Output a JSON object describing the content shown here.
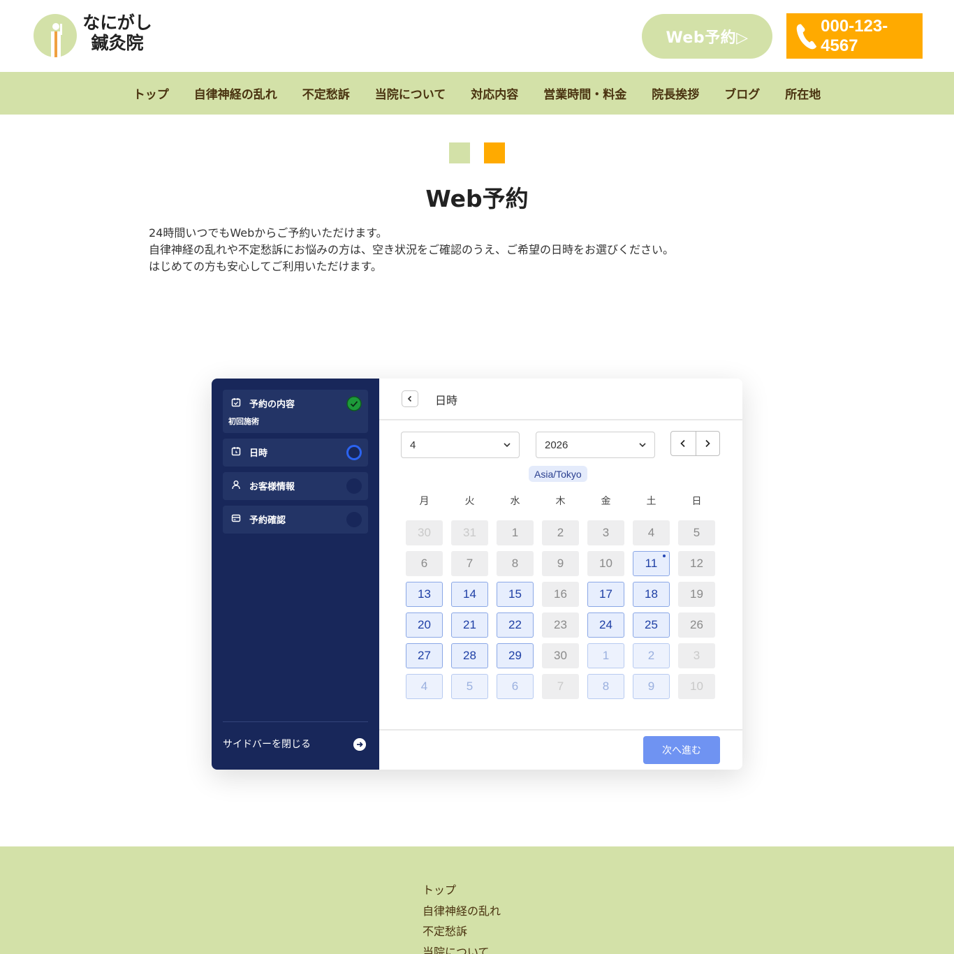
{
  "header": {
    "logo_line1": "なにがし",
    "logo_line2": "鍼灸院",
    "web_button": "Web予約▷",
    "tel_button": "000-123-4567"
  },
  "colors": {
    "green": "#d3e1a8",
    "orange": "#ffaa00",
    "navy": "#18275a",
    "accent_blue": "#6f93f2"
  },
  "nav": [
    "トップ",
    "自律神経の乱れ",
    "不定愁訴",
    "当院について",
    "対応内容",
    "営業時間・料金",
    "院長挨拶",
    "ブログ",
    "所在地"
  ],
  "page": {
    "title": "Web予約",
    "intro": [
      "24時間いつでもWebからご予約いただけます。",
      "自律神経の乱れや不定愁訴にお悩みの方は、空き状況をご確認のうえ、ご希望の日時をお選びください。",
      "はじめての方も安心してご利用いただけます。"
    ]
  },
  "booking": {
    "steps": [
      {
        "label": "予約の内容",
        "sub": "初回施術",
        "icon": "calendar-icon",
        "status": "done"
      },
      {
        "label": "日時",
        "sub": "",
        "icon": "calendar-clock-icon",
        "status": "current"
      },
      {
        "label": "お客様情報",
        "sub": "",
        "icon": "user-icon",
        "status": "pending"
      },
      {
        "label": "予約確認",
        "sub": "",
        "icon": "card-icon",
        "status": "pending"
      }
    ],
    "close_sidebar": "サイドバーを閉じる",
    "section_title": "日時",
    "month_value": "4",
    "year_value": "2026",
    "timezone": "Asia/Tokyo",
    "weekdays": [
      "月",
      "火",
      "水",
      "木",
      "金",
      "土",
      "日"
    ],
    "weeks": [
      [
        {
          "d": "30",
          "s": "other-dis"
        },
        {
          "d": "31",
          "s": "other-dis"
        },
        {
          "d": "1",
          "s": "dis"
        },
        {
          "d": "2",
          "s": "dis"
        },
        {
          "d": "3",
          "s": "dis"
        },
        {
          "d": "4",
          "s": "dis"
        },
        {
          "d": "5",
          "s": "dis"
        }
      ],
      [
        {
          "d": "6",
          "s": "dis"
        },
        {
          "d": "7",
          "s": "dis"
        },
        {
          "d": "8",
          "s": "dis"
        },
        {
          "d": "9",
          "s": "dis"
        },
        {
          "d": "10",
          "s": "dis"
        },
        {
          "d": "11",
          "s": "av today"
        },
        {
          "d": "12",
          "s": "dis"
        }
      ],
      [
        {
          "d": "13",
          "s": "av"
        },
        {
          "d": "14",
          "s": "av"
        },
        {
          "d": "15",
          "s": "av"
        },
        {
          "d": "16",
          "s": "dis"
        },
        {
          "d": "17",
          "s": "av"
        },
        {
          "d": "18",
          "s": "av"
        },
        {
          "d": "19",
          "s": "dis"
        }
      ],
      [
        {
          "d": "20",
          "s": "av"
        },
        {
          "d": "21",
          "s": "av"
        },
        {
          "d": "22",
          "s": "av"
        },
        {
          "d": "23",
          "s": "dis"
        },
        {
          "d": "24",
          "s": "av"
        },
        {
          "d": "25",
          "s": "av"
        },
        {
          "d": "26",
          "s": "dis"
        }
      ],
      [
        {
          "d": "27",
          "s": "av"
        },
        {
          "d": "28",
          "s": "av"
        },
        {
          "d": "29",
          "s": "av"
        },
        {
          "d": "30",
          "s": "dis"
        },
        {
          "d": "1",
          "s": "other-av"
        },
        {
          "d": "2",
          "s": "other-av"
        },
        {
          "d": "3",
          "s": "other-dis"
        }
      ],
      [
        {
          "d": "4",
          "s": "other-av"
        },
        {
          "d": "5",
          "s": "other-av"
        },
        {
          "d": "6",
          "s": "other-av"
        },
        {
          "d": "7",
          "s": "other-dis"
        },
        {
          "d": "8",
          "s": "other-av"
        },
        {
          "d": "9",
          "s": "other-av"
        },
        {
          "d": "10",
          "s": "other-dis"
        }
      ]
    ],
    "next_button": "次へ進む"
  },
  "footer": {
    "links": [
      "トップ",
      "自律神経の乱れ",
      "不定愁訴",
      "当院について"
    ]
  }
}
